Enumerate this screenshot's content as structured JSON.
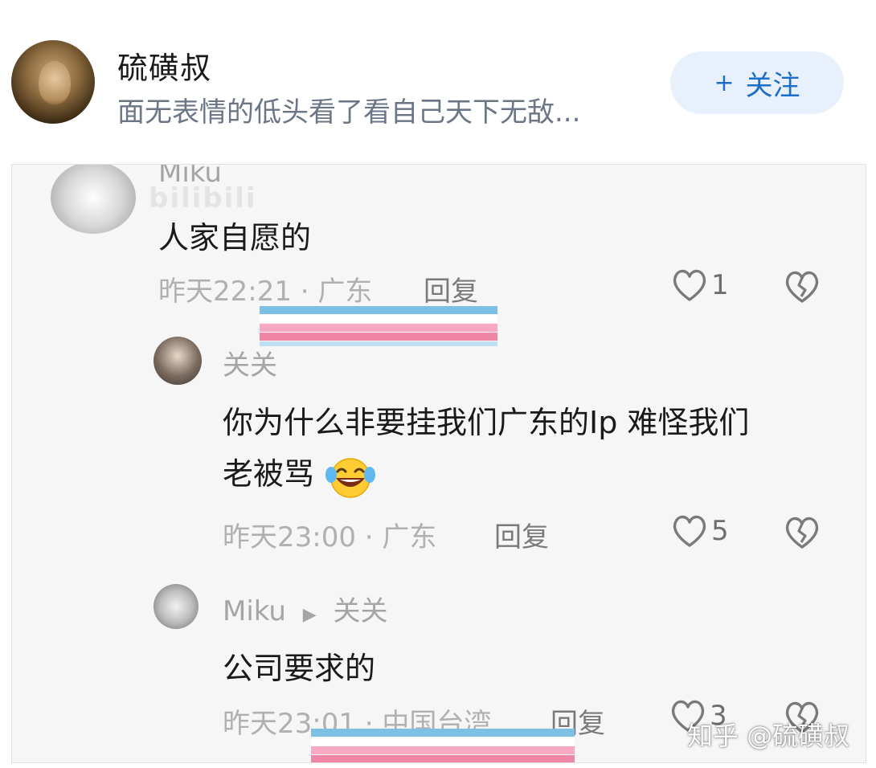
{
  "header": {
    "author_name": "硫磺叔",
    "bio": "面无表情的低头看了看自己天下无敌...",
    "follow_plus": "+",
    "follow_label": "关注"
  },
  "watermarks": {
    "bilibili": "bilibili",
    "zhihu": "知乎 @硫磺叔"
  },
  "comments": [
    {
      "username": "Miku",
      "text": "人家自愿的",
      "time": "昨天22:21 · 广东",
      "reply_label": "回复",
      "likes": "1"
    },
    {
      "username": "关关",
      "text_line1": "你为什么非要挂我们广东的Ip 难怪我们",
      "text_line2": "老被骂",
      "time": "昨天23:00 · 广东",
      "reply_label": "回复",
      "likes": "5"
    },
    {
      "username": "Miku",
      "reply_to": "关关",
      "text": "公司要求的",
      "time": "昨天23:01 · 中国台湾",
      "reply_label": "回复",
      "likes": "3"
    }
  ],
  "colors": {
    "stripe_blue": "#7cc0e6",
    "stripe_pink": "#ef86a6",
    "stripe_white": "#ffffff",
    "follow_text": "#1c6fc8",
    "follow_bg": "#e8f1fb"
  },
  "icons": [
    "heart-icon",
    "broken-heart-icon",
    "laughing-emoji-icon",
    "play-arrow-icon"
  ]
}
